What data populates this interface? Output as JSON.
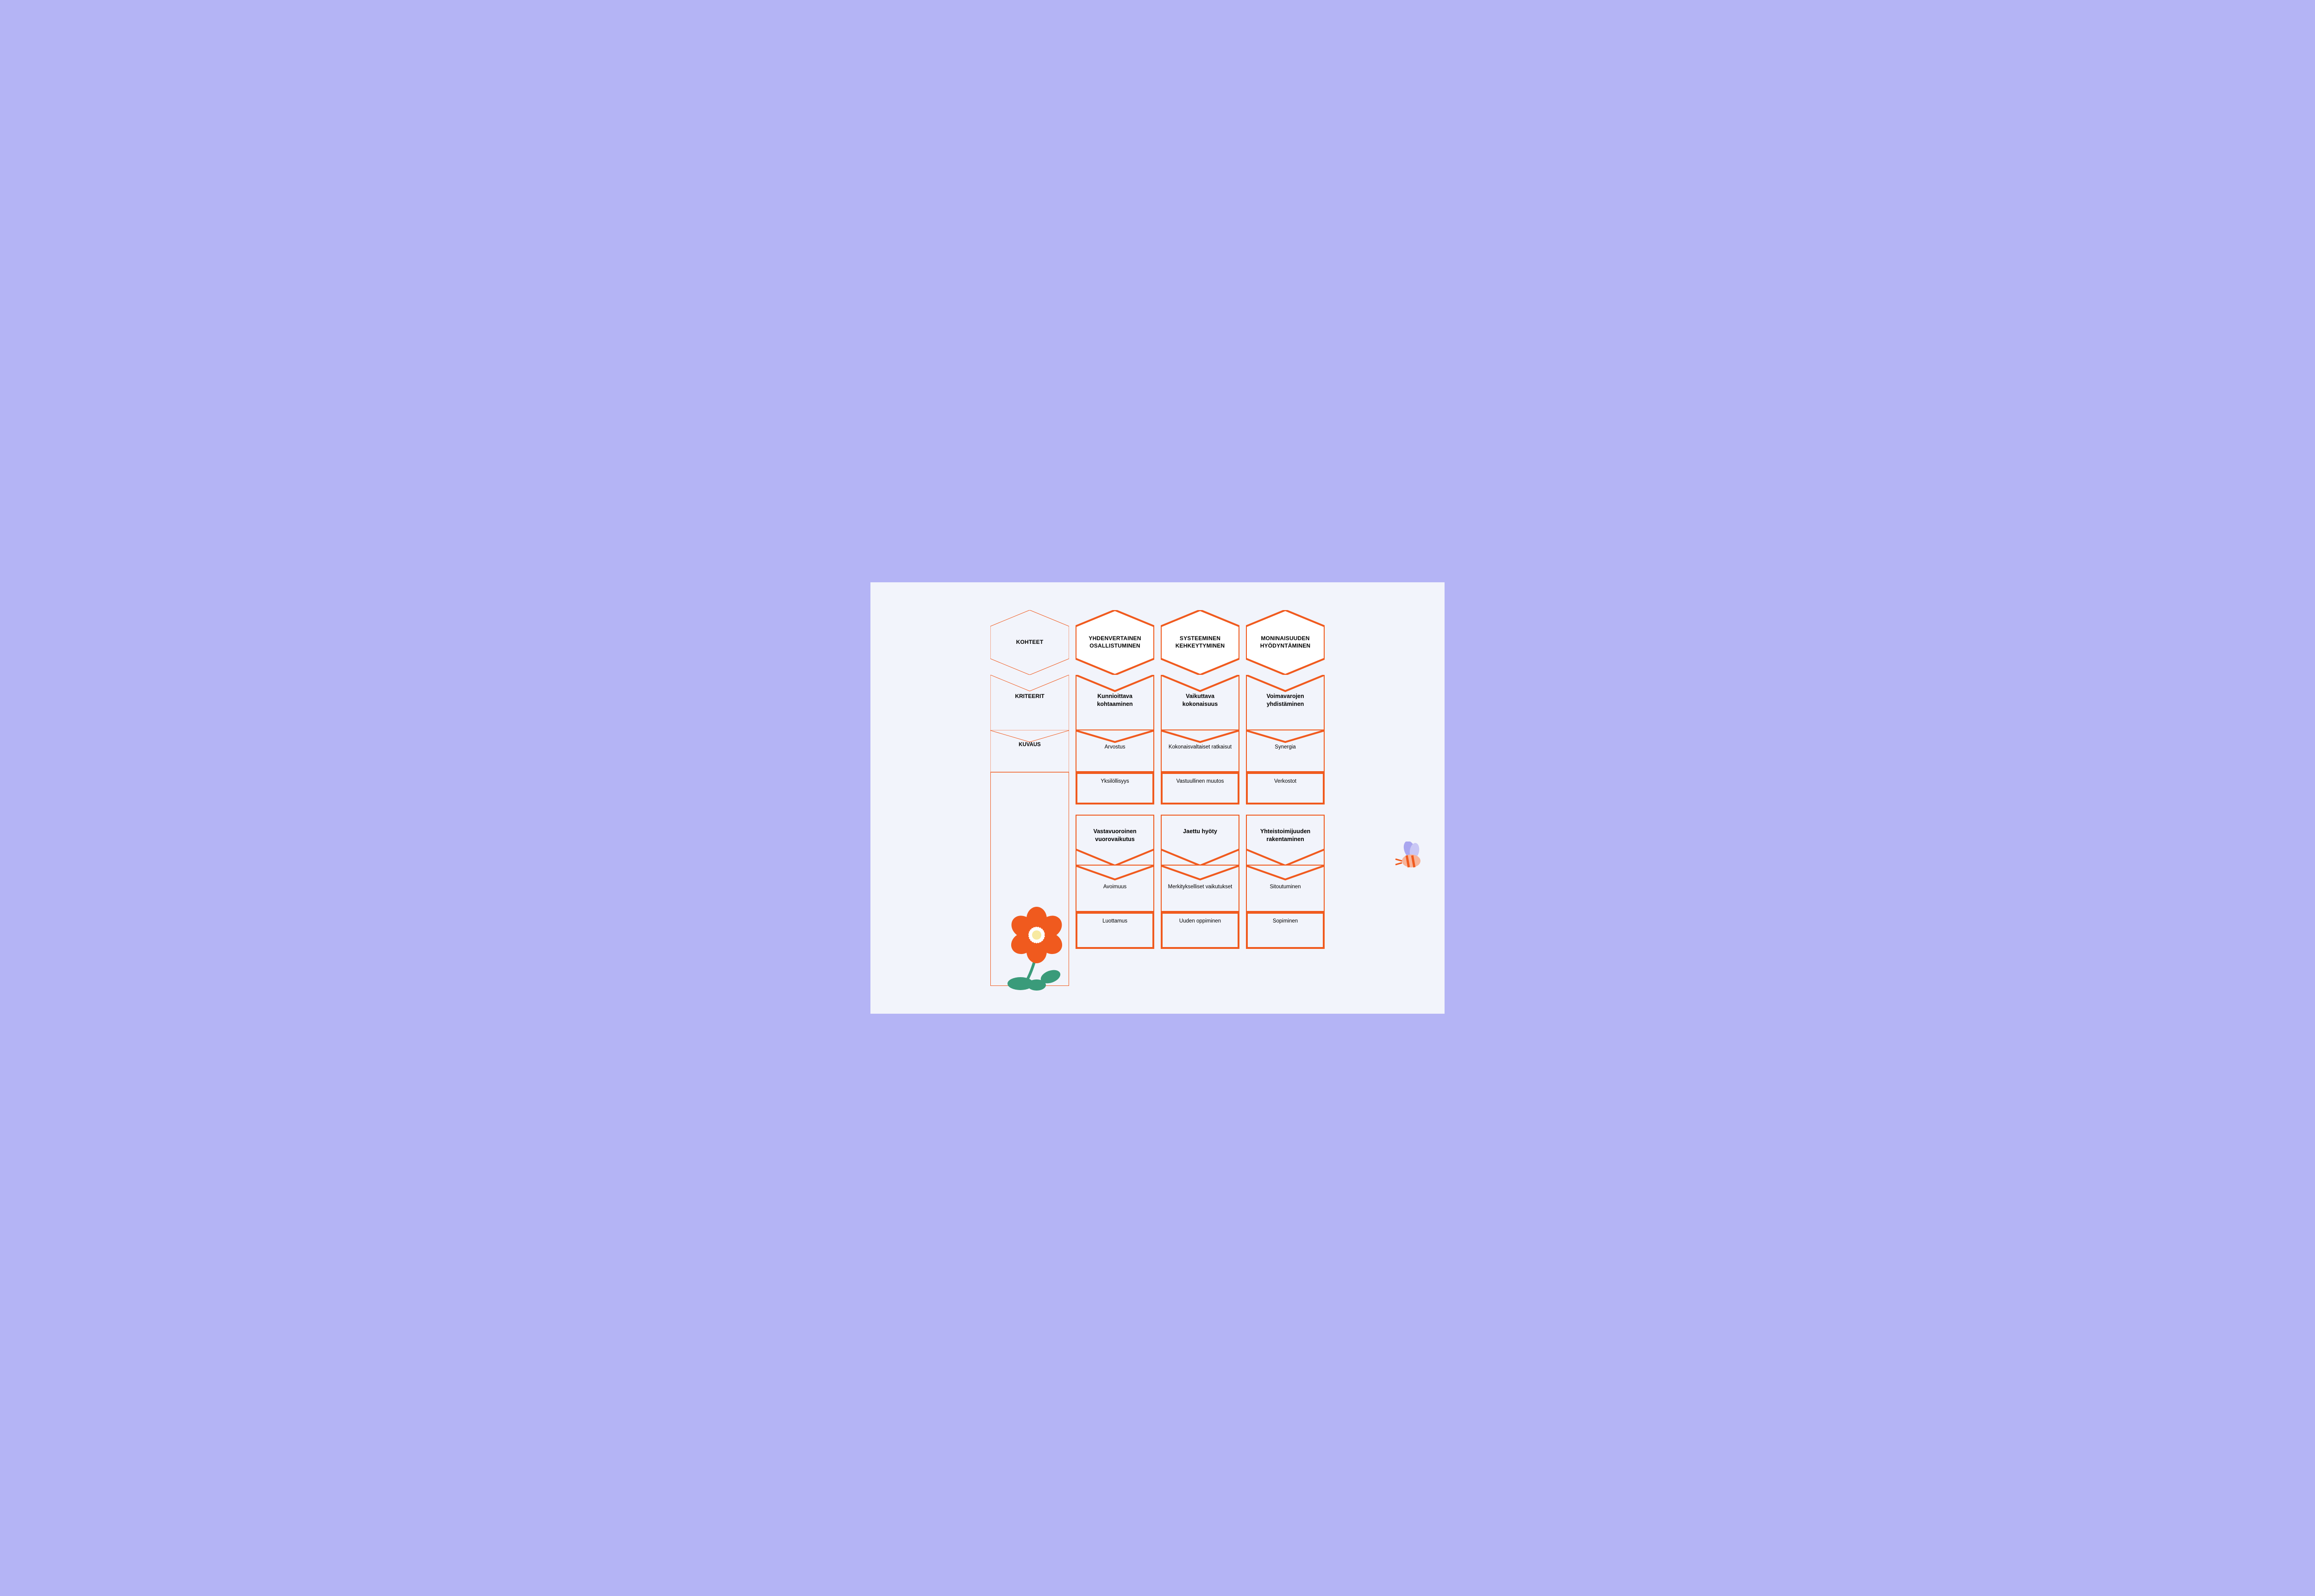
{
  "colors": {
    "accent": "#f05a1e",
    "thin": "#f05a1e",
    "fill_white": "#ffffff",
    "fill_none": "none",
    "page_bg": "#b4b4f5",
    "canvas_bg": "#f2f4fb",
    "leaf": "#3a9b7a",
    "bee_wing": "#a9a6ef",
    "bee_body": "#f7b49a"
  },
  "sidebar": {
    "kohteet": "KOHTEET",
    "kriteerit": "KRITEERIT",
    "kuvaus": "KUVAUS"
  },
  "columns": [
    {
      "header": "YHDENVERTAINEN\nOSALLISTUMINEN",
      "criteria1": "Kunnioittava\nkohtaaminen",
      "desc1a": "Arvostus",
      "desc1b": "Yksilöllisyys",
      "criteria2": "Vastavuoroinen\nvuorovaikutus",
      "desc2a": "Avoimuus",
      "desc2b": "Luottamus"
    },
    {
      "header": "SYSTEEMINEN\nKEHKEYTYMINEN",
      "criteria1": "Vaikuttava\nkokonaisuus",
      "desc1a": "Kokonaisvaltaiset ratkaisut",
      "desc1b": "Vastuullinen muutos",
      "criteria2": "Jaettu hyöty",
      "desc2a": "Merkitykselliset vaikutukset",
      "desc2b": "Uuden oppiminen"
    },
    {
      "header": "MONINAISUUDEN\nHYÖDYNTÄMINEN",
      "criteria1": "Voimavarojen\nyhdistäminen",
      "desc1a": "Synergia",
      "desc1b": "Verkostot",
      "criteria2": "Yhteistoimijuuden\nrakentaminen",
      "desc2a": "Sitoutuminen",
      "desc2b": "Sopiminen"
    }
  ]
}
